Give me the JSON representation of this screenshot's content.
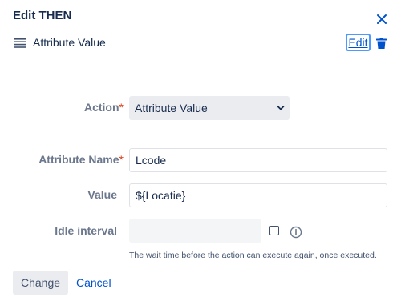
{
  "dialog": {
    "title": "Edit THEN"
  },
  "row": {
    "label": "Attribute Value",
    "edit_label": "Edit"
  },
  "form": {
    "action": {
      "label": "Action",
      "required_mark": "*",
      "selected": "Attribute Value"
    },
    "attribute_name": {
      "label": "Attribute Name",
      "required_mark": "*",
      "value": "Lcode"
    },
    "value": {
      "label": "Value",
      "value": "${Locatie}"
    },
    "idle_interval": {
      "label": "Idle interval",
      "value": "",
      "checked": false,
      "help": "The wait time before the action can execute again, once executed."
    }
  },
  "footer": {
    "change_label": "Change",
    "cancel_label": "Cancel"
  },
  "colors": {
    "link": "#0052cc",
    "required": "#de350b",
    "label": "#6b778c",
    "text": "#172b4d"
  },
  "icons": {
    "close": "close-icon",
    "drag": "drag-handle-icon",
    "trash": "trash-icon",
    "chevron": "chevron-down-icon",
    "info": "info-icon"
  }
}
